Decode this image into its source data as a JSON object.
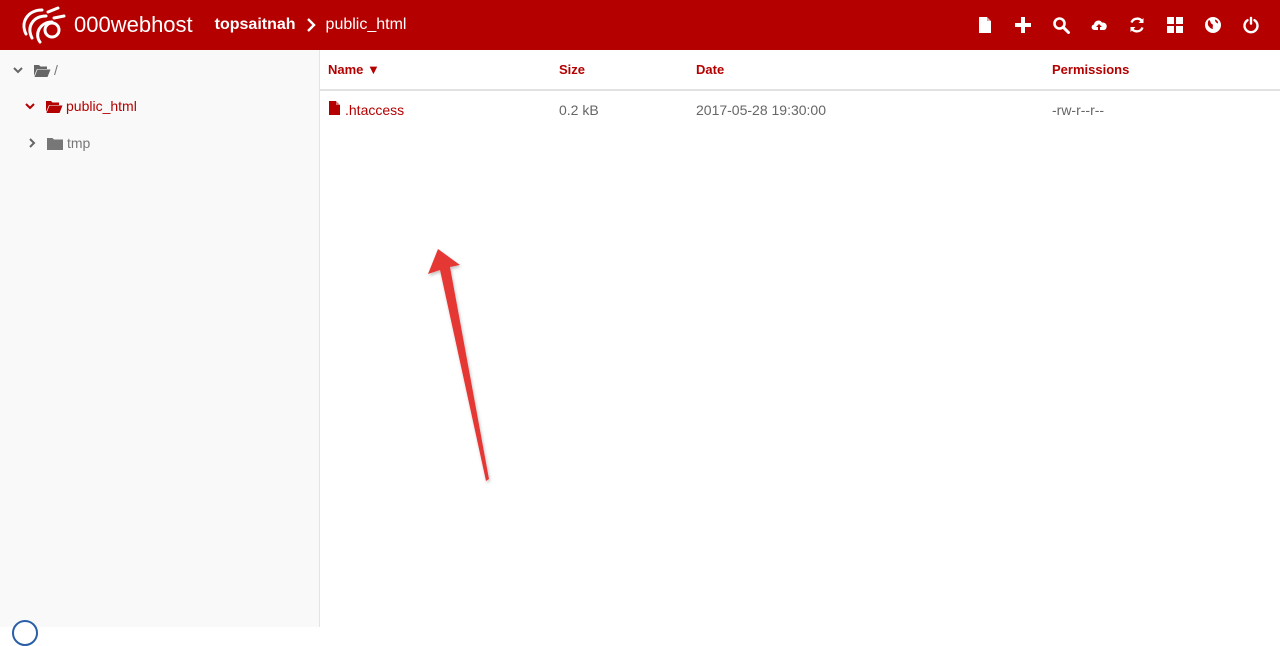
{
  "app": {
    "brand": "000webhost"
  },
  "breadcrumb": {
    "items": [
      "topsaitnah",
      "public_html"
    ]
  },
  "toolbar": {
    "icons": [
      "new-file-icon",
      "plus-icon",
      "search-icon",
      "upload-icon",
      "refresh-icon",
      "grid-icon",
      "globe-icon",
      "power-icon"
    ]
  },
  "tree": {
    "root_label": "/",
    "items": [
      {
        "label": "public_html",
        "expanded": true,
        "selected": true
      },
      {
        "label": "tmp",
        "expanded": false,
        "selected": false
      }
    ]
  },
  "table": {
    "columns": {
      "name": "Name ▼",
      "size": "Size",
      "date": "Date",
      "permissions": "Permissions"
    },
    "rows": [
      {
        "name": ".htaccess",
        "size": "0.2 kB",
        "date": "2017-05-28 19:30:00",
        "permissions": "-rw-r--r--"
      }
    ]
  },
  "colors": {
    "brand": "#b50000",
    "annotation_arrow": "#e53935",
    "sidebar_bg": "#f9f9f9"
  }
}
